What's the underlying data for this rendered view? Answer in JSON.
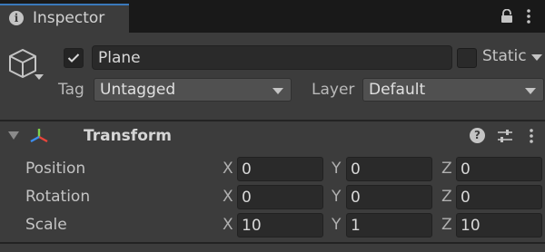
{
  "tab": {
    "title": "Inspector",
    "icon": "info-icon"
  },
  "toolbar": {
    "lock_icon": "lock-icon",
    "more_icon": "kebab-menu-icon"
  },
  "gameobject": {
    "icon": "cube-icon",
    "active": true,
    "name": "Plane",
    "static_label": "Static",
    "static_checked": false,
    "tag_label": "Tag",
    "tag_value": "Untagged",
    "layer_label": "Layer",
    "layer_value": "Default"
  },
  "component": {
    "title": "Transform",
    "expanded": true,
    "icons": [
      "transform-axes-icon",
      "help-icon",
      "preset-sliders-icon",
      "kebab-menu-icon"
    ],
    "rows": [
      {
        "label": "Position",
        "x": "0",
        "y": "0",
        "z": "0"
      },
      {
        "label": "Rotation",
        "x": "0",
        "y": "0",
        "z": "0"
      },
      {
        "label": "Scale",
        "x": "10",
        "y": "1",
        "z": "10"
      }
    ],
    "axis_labels": {
      "x": "X",
      "y": "Y",
      "z": "Z"
    }
  },
  "colors": {
    "panel_bg": "#3c3c3c",
    "tab_accent": "#3a79bb",
    "field_bg": "#2a2a2a",
    "dropdown_bg": "#505050"
  }
}
